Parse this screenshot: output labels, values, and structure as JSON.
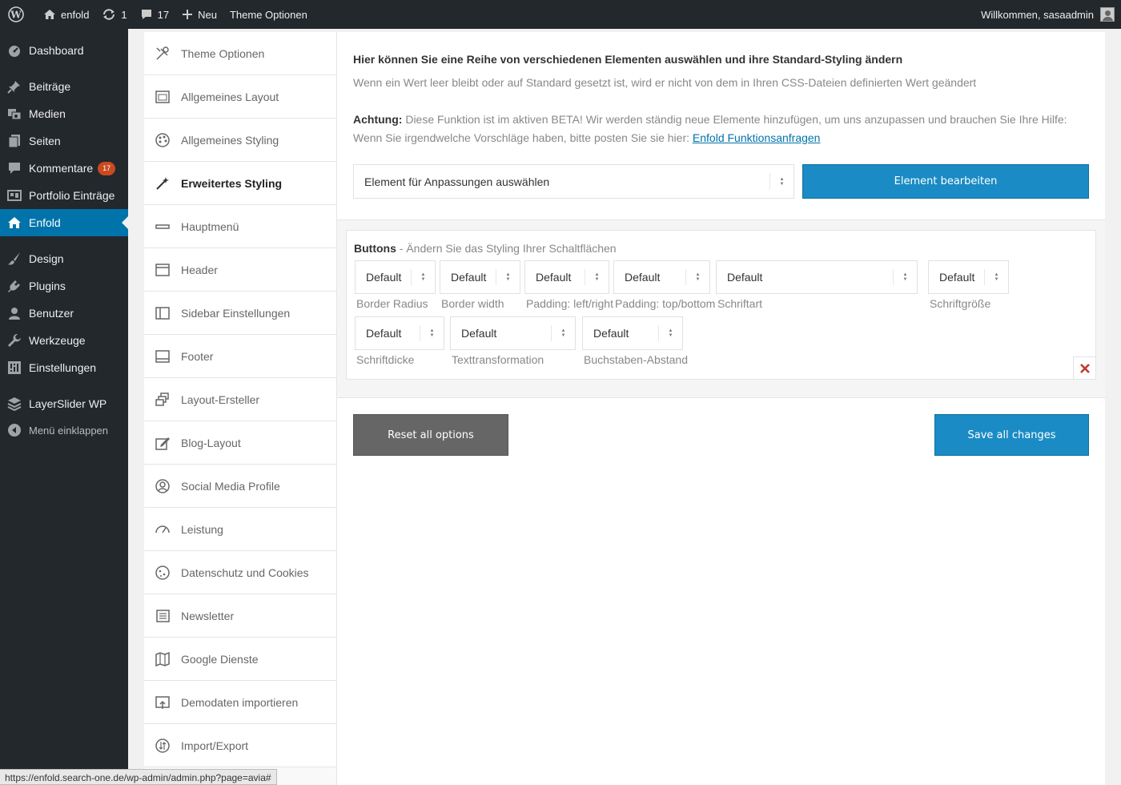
{
  "adminbar": {
    "site_name": "enfold",
    "updates_count": "1",
    "comments_count": "17",
    "new_label": "Neu",
    "theme_options_label": "Theme Optionen",
    "welcome": "Willkommen, sasaadmin"
  },
  "menu": {
    "items": [
      {
        "label": "Dashboard",
        "icon": "dashboard-icon"
      },
      {
        "label": "Beiträge",
        "icon": "pin-icon"
      },
      {
        "label": "Medien",
        "icon": "media-icon"
      },
      {
        "label": "Seiten",
        "icon": "pages-icon"
      },
      {
        "label": "Kommentare",
        "icon": "comment-icon",
        "badge": "17"
      },
      {
        "label": "Portfolio Einträge",
        "icon": "portfolio-icon"
      },
      {
        "label": "Enfold",
        "icon": "home-icon"
      },
      {
        "label": "Design",
        "icon": "brush-icon"
      },
      {
        "label": "Plugins",
        "icon": "plugin-icon"
      },
      {
        "label": "Benutzer",
        "icon": "user-icon"
      },
      {
        "label": "Werkzeuge",
        "icon": "wrench-icon"
      },
      {
        "label": "Einstellungen",
        "icon": "settings-icon"
      },
      {
        "label": "LayerSlider WP",
        "icon": "layers-icon"
      },
      {
        "label": "Menü einklappen",
        "icon": "collapse-icon"
      }
    ]
  },
  "options_nav": {
    "items": [
      {
        "label": "Theme Optionen"
      },
      {
        "label": "Allgemeines Layout"
      },
      {
        "label": "Allgemeines Styling"
      },
      {
        "label": "Erweitertes Styling"
      },
      {
        "label": "Hauptmenü"
      },
      {
        "label": "Header"
      },
      {
        "label": "Sidebar Einstellungen"
      },
      {
        "label": "Footer"
      },
      {
        "label": "Layout-Ersteller"
      },
      {
        "label": "Blog-Layout"
      },
      {
        "label": "Social Media Profile"
      },
      {
        "label": "Leistung"
      },
      {
        "label": "Datenschutz und Cookies"
      },
      {
        "label": "Newsletter"
      },
      {
        "label": "Google Dienste"
      },
      {
        "label": "Demodaten importieren"
      },
      {
        "label": "Import/Export"
      }
    ]
  },
  "main": {
    "heading": "Hier können Sie eine Reihe von verschiedenen Elementen auswählen und ihre Standard-Styling ändern",
    "subheading": "Wenn ein Wert leer bleibt oder auf Standard gesetzt ist, wird er nicht von dem in Ihren CSS-Dateien definierten Wert geändert",
    "notice_label": "Achtung:",
    "notice_text": " Diese Funktion ist im aktiven BETA! Wir werden ständig neue Elemente hinzufügen, um uns anzupassen und brauchen Sie Ihre Hilfe: Wenn Sie irgendwelche Vorschläge haben, bitte posten Sie sie hier: ",
    "notice_link": "Enfold Funktionsanfragen",
    "element_select": "Element für Anpassungen auswählen",
    "edit_button": "Element bearbeiten",
    "buttons_section": {
      "title": "Buttons",
      "subtitle": " - Ändern Sie das Styling Ihrer Schaltflächen",
      "fields": [
        {
          "value": "Default",
          "label": "Border Radius"
        },
        {
          "value": "Default",
          "label": "Border width"
        },
        {
          "value": "Default",
          "label": "Padding: left/right"
        },
        {
          "value": "Default",
          "label": "Padding: top/bottom"
        },
        {
          "value": "Default",
          "label": "Schriftart"
        },
        {
          "value": "Default",
          "label": "Schriftgröße"
        },
        {
          "value": "Default",
          "label": "Schriftdicke"
        },
        {
          "value": "Default",
          "label": "Texttransformation"
        },
        {
          "value": "Default",
          "label": "Buchstaben-Abstand"
        }
      ]
    },
    "reset_button": "Reset all options",
    "save_button": "Save all changes"
  },
  "statusbar": {
    "url": "https://enfold.search-one.de/wp-admin/admin.php?page=avia#"
  },
  "colors": {
    "accent": "#1a8bc4",
    "menu_bg": "#23282d",
    "menu_current": "#0073aa",
    "badge": "#ca4a1f",
    "remove": "#c1392b"
  }
}
